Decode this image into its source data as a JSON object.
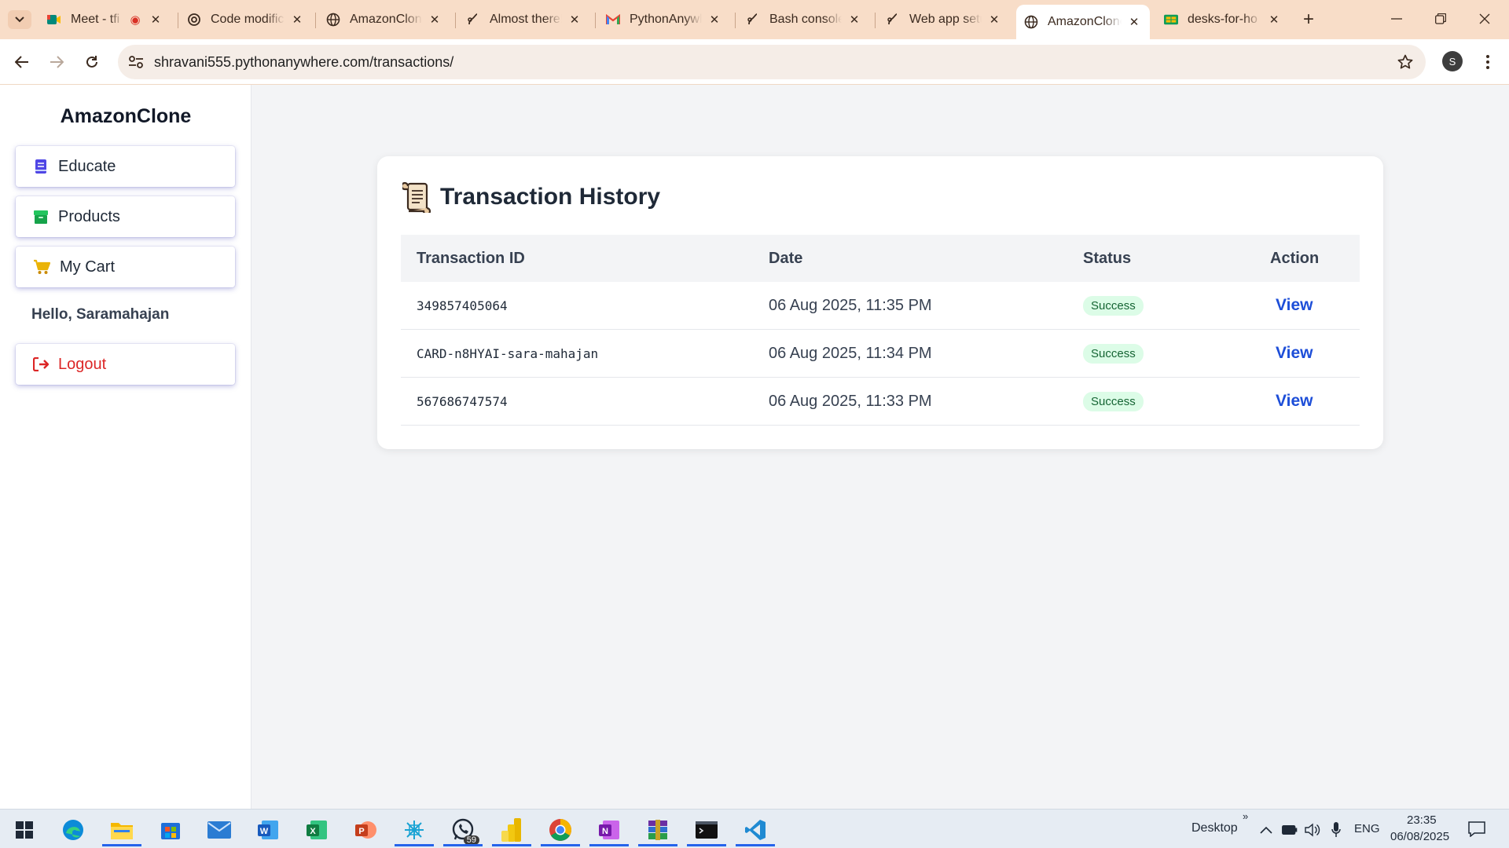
{
  "browser": {
    "tabs": [
      {
        "label": "Meet - tfi",
        "favicon": "google-meet-icon"
      },
      {
        "label": "Code modific",
        "favicon": "chatgpt-icon"
      },
      {
        "label": "AmazonClone",
        "favicon": "globe-icon"
      },
      {
        "label": "Almost there!",
        "favicon": "pythonanywhere-icon"
      },
      {
        "label": "PythonAnywh",
        "favicon": "gmail-icon"
      },
      {
        "label": "Bash console",
        "favicon": "pythonanywhere-icon"
      },
      {
        "label": "Web app setu",
        "favicon": "pythonanywhere-icon"
      },
      {
        "label": "AmazonClone",
        "favicon": "globe-icon",
        "active": true
      },
      {
        "label": "desks-for-ho",
        "favicon": "sheets-icon"
      }
    ],
    "url": "shravani555.pythonanywhere.com/transactions/",
    "profile_initial": "S"
  },
  "sidebar": {
    "brand": "AmazonClone",
    "educate": "Educate",
    "products": "Products",
    "cart": "My Cart",
    "greeting": "Hello, Saramahajan",
    "logout": "Logout"
  },
  "main": {
    "title": "Transaction History",
    "columns": {
      "id": "Transaction ID",
      "date": "Date",
      "status": "Status",
      "action": "Action"
    },
    "rows": [
      {
        "id": "349857405064",
        "date": "06 Aug 2025, 11:35 PM",
        "status": "Success",
        "action": "View"
      },
      {
        "id": "CARD-n8HYAI-sara-mahajan",
        "date": "06 Aug 2025, 11:34 PM",
        "status": "Success",
        "action": "View"
      },
      {
        "id": "567686747574",
        "date": "06 Aug 2025, 11:33 PM",
        "status": "Success",
        "action": "View"
      }
    ]
  },
  "taskbar": {
    "desktop_label": "Desktop",
    "whatsapp_badge": "59",
    "language": "ENG",
    "time": "23:35",
    "date": "06/08/2025"
  },
  "colors": {
    "accent": "#1d4ed8",
    "success_bg": "#dcfce7",
    "success_text": "#166534",
    "logout": "#dc2626",
    "tabbar": "#f8ddc8"
  }
}
